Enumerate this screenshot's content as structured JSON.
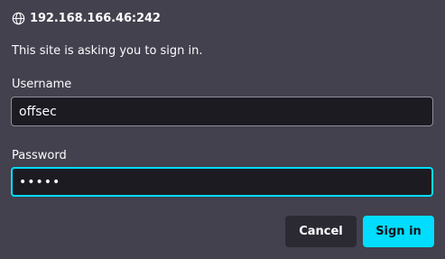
{
  "dialog": {
    "origin": "192.168.166.46:242",
    "origin_icon": "globe-icon",
    "message": "This site is asking you to sign in."
  },
  "form": {
    "username_label": "Username",
    "username_value": "offsec",
    "password_label": "Password",
    "password_value": "•••••"
  },
  "buttons": {
    "cancel_label": "Cancel",
    "signin_label": "Sign in"
  },
  "colors": {
    "background": "#42414d",
    "field_background": "#1c1b22",
    "accent": "#00ddff",
    "secondary_button": "#2b2a33",
    "text": "#fbfbfe"
  }
}
